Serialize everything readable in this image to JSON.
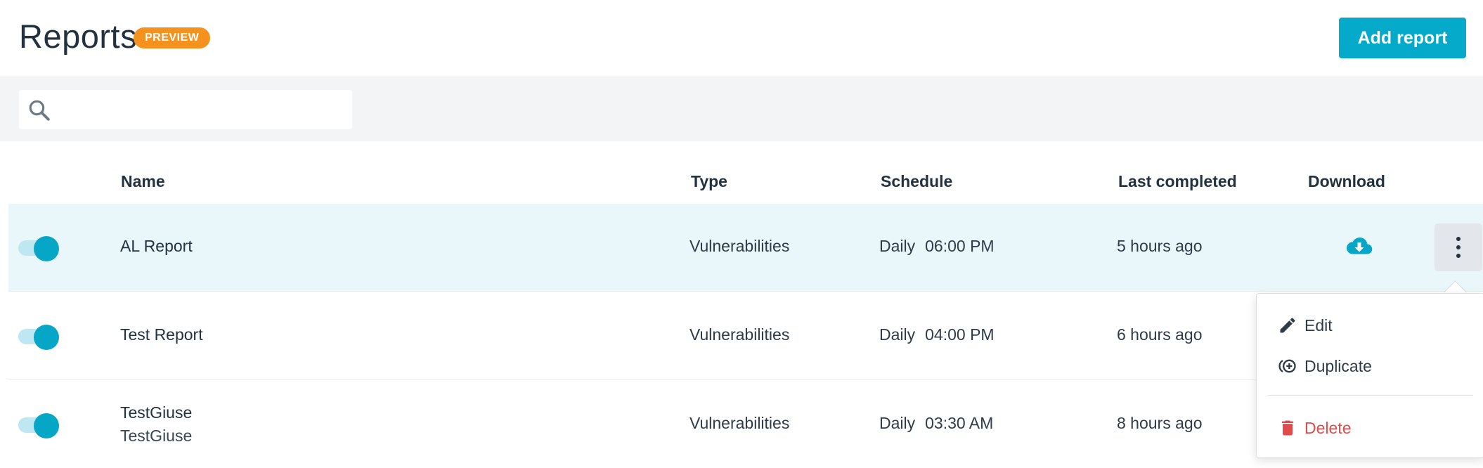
{
  "header": {
    "title": "Reports",
    "badge": "PREVIEW",
    "add_button": "Add report"
  },
  "search": {
    "value": "",
    "placeholder": ""
  },
  "columns": {
    "name": "Name",
    "type": "Type",
    "schedule": "Schedule",
    "last_completed": "Last completed",
    "download": "Download"
  },
  "rows": [
    {
      "name": "AL Report",
      "subtitle": "",
      "type": "Vulnerabilities",
      "frequency": "Daily",
      "time": "06:00 PM",
      "last": "5 hours ago",
      "enabled": true,
      "selected": true
    },
    {
      "name": "Test Report",
      "subtitle": "",
      "type": "Vulnerabilities",
      "frequency": "Daily",
      "time": "04:00 PM",
      "last": "6 hours ago",
      "enabled": true,
      "selected": false
    },
    {
      "name": "TestGiuse",
      "subtitle": "TestGiuse",
      "type": "Vulnerabilities",
      "frequency": "Daily",
      "time": "03:30 AM",
      "last": "8 hours ago",
      "enabled": true,
      "selected": false
    }
  ],
  "menu": {
    "edit": "Edit",
    "duplicate": "Duplicate",
    "delete": "Delete"
  },
  "colors": {
    "accent": "#05a9c9",
    "badge": "#f5921e",
    "danger": "#e24b4b",
    "selected_row": "#e9f7fa"
  },
  "icons": {
    "search": "search-icon",
    "download": "cloud-download-icon",
    "kebab": "kebab-icon",
    "edit": "pencil-icon",
    "duplicate": "duplicate-icon",
    "delete": "trash-icon"
  }
}
